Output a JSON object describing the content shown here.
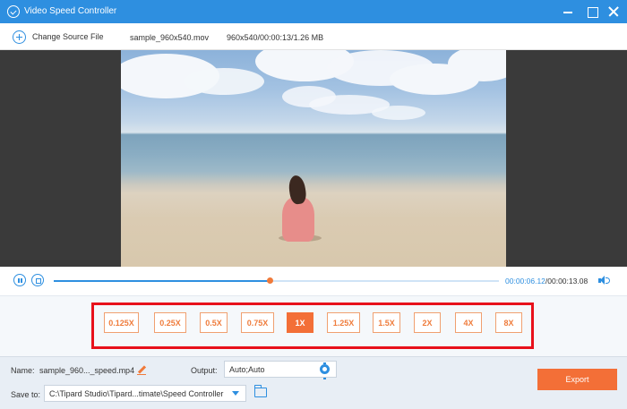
{
  "window": {
    "title": "Video Speed Controller",
    "accent_color": "#2e8fe0"
  },
  "toolbar": {
    "add_label": "Change Source File",
    "file_name": "sample_960x540.mov",
    "file_info": "960x540/00:00:13/1.26 MB"
  },
  "player": {
    "current_time": "00:00:06.12",
    "total_time": "/00:00:13.08",
    "progress": 0.486
  },
  "speed": {
    "options": [
      "0.125X",
      "0.25X",
      "0.5X",
      "0.75X",
      "1X",
      "1.25X",
      "1.5X",
      "2X",
      "4X",
      "8X"
    ],
    "selected": "1X",
    "highlight_color": "#e8111b",
    "button_color": "#f36f37"
  },
  "settings": {
    "name_label": "Name:",
    "name_value": "sample_960..._speed.mp4",
    "output_label": "Output:",
    "output_value": "Auto;Auto",
    "save_label": "Save to:",
    "save_path": "C:\\Tipard Studio\\Tipard...timate\\Speed Controller",
    "export_label": "Export"
  }
}
